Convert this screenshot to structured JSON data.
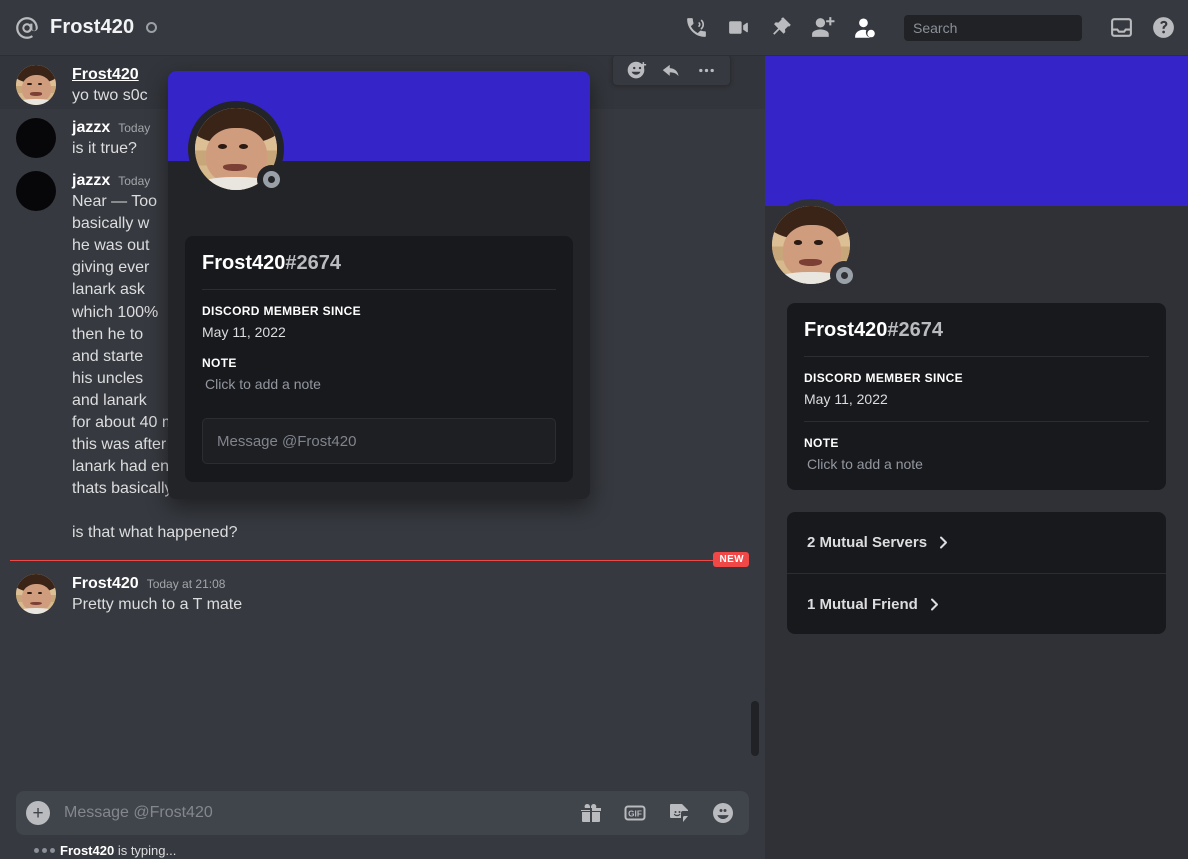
{
  "header": {
    "at_icon": "mention-icon",
    "dm_name": "Frost420",
    "status": "offline",
    "icons": [
      {
        "name": "start-voice-call-icon",
        "label": "Start Voice Call"
      },
      {
        "name": "start-video-call-icon",
        "label": "Start Video Call"
      },
      {
        "name": "pinned-messages-icon",
        "label": "Pinned Messages"
      },
      {
        "name": "add-friends-icon",
        "label": "Add Friends to DM"
      },
      {
        "name": "user-profile-icon",
        "label": "Hide User Profile"
      },
      {
        "name": "inbox-icon",
        "label": "Inbox"
      },
      {
        "name": "help-icon",
        "label": "Help"
      }
    ],
    "search": {
      "placeholder": "Search",
      "value": "",
      "icon": "search-icon"
    }
  },
  "messages": [
    {
      "author": "Frost420",
      "author_link": true,
      "timestamp": "",
      "avatar": "face",
      "text": "yo two s0c",
      "hovered": true
    },
    {
      "author": "jazzx",
      "author_link": false,
      "timestamp": "Today",
      "avatar": "blank",
      "text": "is it true?",
      "hovered": false
    },
    {
      "author": "jazzx",
      "author_link": false,
      "timestamp": "Today",
      "avatar": "blank",
      "text": "Near — Too\nbasically w\nhe was out\ngiving ever\nlanark ask\nwhich 100%\nthen he to\nand starte                                        erts\nhis uncles\nand lanark\nfor about 40 mins straight\nthis was after giving him the 1b\nlanark had enough of the abuse\nthats basically were the story is at\n\nis that what happened?",
      "hovered": false
    }
  ],
  "divider": {
    "label": "NEW"
  },
  "last_message": {
    "author": "Frost420",
    "timestamp": "Today at 21:08",
    "text": "Pretty much to a T mate",
    "avatar": "face"
  },
  "hover_actions": [
    {
      "name": "add-reaction-icon",
      "label": "Add Reaction"
    },
    {
      "name": "reply-icon",
      "label": "Reply"
    },
    {
      "name": "more-options-icon",
      "label": "More"
    }
  ],
  "composer": {
    "placeholder": "Message @Frost420",
    "value": "",
    "plus": "+",
    "icons": [
      {
        "name": "gift-icon",
        "label": "Gift"
      },
      {
        "name": "gif-icon",
        "label": "GIF"
      },
      {
        "name": "sticker-icon",
        "label": "Sticker"
      },
      {
        "name": "emoji-icon",
        "label": "Emoji"
      }
    ]
  },
  "typing": {
    "user": "Frost420",
    "suffix": " is typing..."
  },
  "profile_popout": {
    "banner_color": "#3524C8",
    "username": "Frost420",
    "discriminator": "#2674",
    "member_since_label": "DISCORD MEMBER SINCE",
    "member_since_value": "May 11, 2022",
    "note_label": "NOTE",
    "note_placeholder": "Click to add a note",
    "message_placeholder": "Message @Frost420"
  },
  "sidebar": {
    "banner_color": "#3524C8",
    "username": "Frost420",
    "discriminator": "#2674",
    "member_since_label": "DISCORD MEMBER SINCE",
    "member_since_value": "May 11, 2022",
    "note_label": "NOTE",
    "note_placeholder": "Click to add a note",
    "mutuals": [
      {
        "label": "2 Mutual Servers",
        "icon": "chevron-right-icon"
      },
      {
        "label": "1 Mutual Friend",
        "icon": "chevron-right-icon"
      }
    ]
  }
}
